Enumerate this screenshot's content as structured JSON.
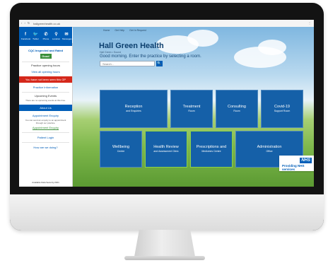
{
  "browser": {
    "nav_icons": "‹ › ↻",
    "url": "hallgreenhealth.co.uk",
    "menu": "⋮"
  },
  "sidebar": {
    "icons": [
      {
        "icon": "facebook-icon",
        "glyph": "f",
        "label": "Facebook"
      },
      {
        "icon": "twitter-icon",
        "glyph": "🐦",
        "label": "Twitter"
      },
      {
        "icon": "phone-icon",
        "glyph": "✆",
        "label": "Phone"
      },
      {
        "icon": "location-icon",
        "glyph": "⚲",
        "label": "Location"
      },
      {
        "icon": "email-icon",
        "glyph": "✉",
        "label": "Messages"
      }
    ],
    "cqc_label": "CQC Inspected and Rated",
    "cqc_rating": "Good",
    "opening_label": "Practice opening hours",
    "opening_link": "View all opening hours",
    "red_banner": "You have not been seen this GP",
    "practice_info": "Practice Information",
    "upcoming_events": "Upcoming Events",
    "upcoming_sub": "There are no upcoming events at this time.",
    "about_us": "About Us",
    "appointment_title": "Appointment Enquiry",
    "appointment_sub": "You can send an enquiry to an appointment through our practice.",
    "appointment_link": "Appointment Enquiry",
    "patient_login": "Patient Login",
    "how_are_we_doing": "How are we doing?",
    "bottom_text": "Available Data Security 2021"
  },
  "collapse": {
    "label": "Hide"
  },
  "main": {
    "breadcrumbs": [
      "Home",
      "Get Help",
      "Get In Request"
    ],
    "title": "Hall Green Health",
    "subtitle": "Hall Green • Sound",
    "greeting": "Good morning. Enter the practice by selecting a room.",
    "search_placeholder": "Search...",
    "search_button": "🔍"
  },
  "tiles": [
    {
      "title": "Reception",
      "sub": "and Enquiries"
    },
    {
      "title": "Treatment",
      "sub": "Room"
    },
    {
      "title": "Consulting",
      "sub": "Room"
    },
    {
      "title": "Covid-19",
      "sub": "Support Room"
    },
    {
      "title": "Wellbeing",
      "sub": "Centre"
    },
    {
      "title": "Health Review",
      "sub": "and Assessment Clinic"
    },
    {
      "title": "Prescriptions and",
      "sub": "Medicines Centre"
    },
    {
      "title": "Administration",
      "sub": "Office"
    }
  ],
  "nhs": {
    "logo": "NHS",
    "text": "Providing NHS services"
  }
}
